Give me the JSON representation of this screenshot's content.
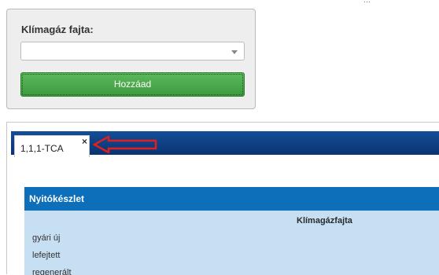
{
  "top_cut_text": "...",
  "form": {
    "label": "Klímagáz fajta:",
    "select_value": "",
    "add_button": "Hozzáad"
  },
  "tabs": [
    {
      "label": "1,1,1-TCA",
      "close_icon": "×"
    }
  ],
  "panel": {
    "title": "Nyitókészlet",
    "column_header": "Klímagázfajta",
    "rows": [
      "gyári új",
      "lefejtett",
      "regenerált"
    ]
  },
  "colors": {
    "annotation_arrow": "#e02020",
    "tab_bar": "#0d3f86",
    "panel_header": "#0d6eb9",
    "panel_body": "#c6dff3",
    "add_button": "#4cae4c"
  }
}
